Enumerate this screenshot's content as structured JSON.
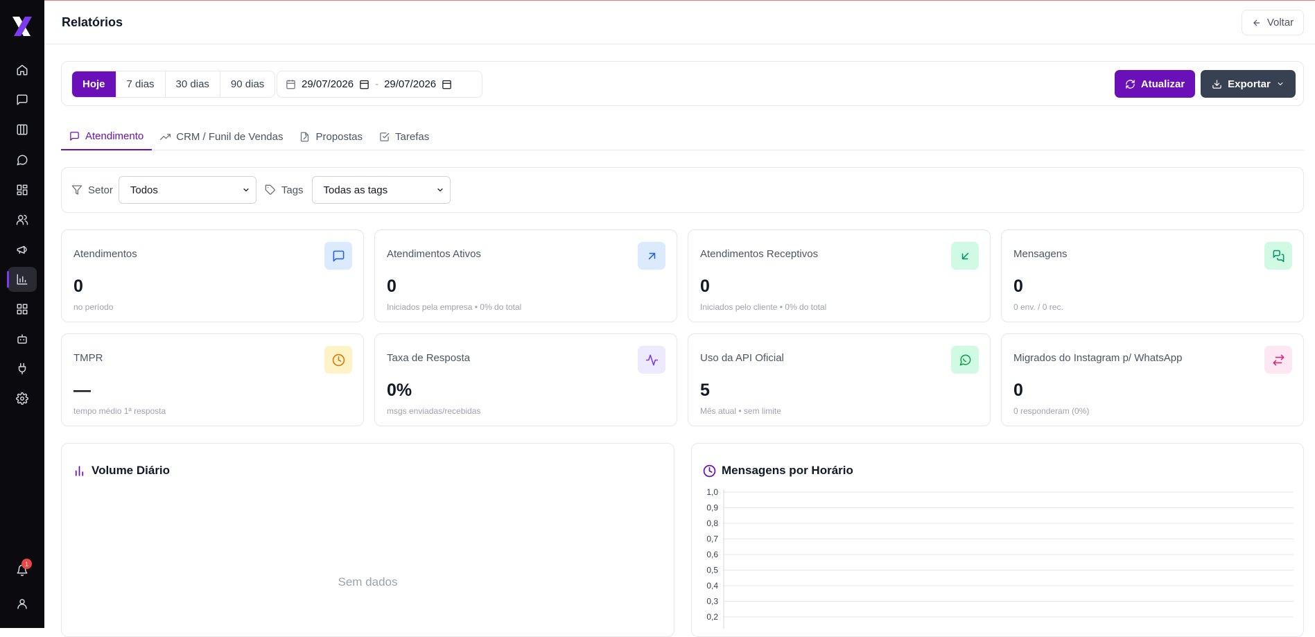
{
  "app": {
    "page_title": "Relatórios",
    "back_label": "Voltar",
    "notification_count": "1"
  },
  "sidebar": {
    "items": [
      "home-icon",
      "chat-icon",
      "kanban-icon",
      "message-circle-icon",
      "dashboard-icon",
      "users-icon",
      "megaphone-icon",
      "chart-icon",
      "apps-icon",
      "bot-icon",
      "plug-icon",
      "settings-icon"
    ]
  },
  "ranges": [
    {
      "label": "Hoje",
      "active": true
    },
    {
      "label": "7 dias"
    },
    {
      "label": "30 dias"
    },
    {
      "label": "90 dias"
    }
  ],
  "dates": {
    "start": "29/07/2026",
    "end": "29/07/2026",
    "separator": "-"
  },
  "actions": {
    "update": "Atualizar",
    "export": "Exportar"
  },
  "tabs": [
    {
      "label": "Atendimento",
      "active": true
    },
    {
      "label": "CRM / Funil de Vendas"
    },
    {
      "label": "Propostas"
    },
    {
      "label": "Tarefas"
    }
  ],
  "filters": {
    "sector_label": "Setor",
    "sector_value": "Todos",
    "tags_label": "Tags",
    "tags_value": "Todas as tags"
  },
  "cards": [
    {
      "title": "Atendimentos",
      "value": "0",
      "sub": "no período",
      "icon": "message-square-icon",
      "color": "#2563eb",
      "bg": "#dbeafe"
    },
    {
      "title": "Atendimentos Ativos",
      "value": "0",
      "sub": "Iniciados pela empresa • 0% do total",
      "icon": "arrow-up-right-icon",
      "color": "#2563eb",
      "bg": "#dbeafe"
    },
    {
      "title": "Atendimentos Receptivos",
      "value": "0",
      "sub": "Iniciados pelo cliente • 0% do total",
      "icon": "arrow-down-left-icon",
      "color": "#059669",
      "bg": "#d1fae5"
    },
    {
      "title": "Mensagens",
      "value": "0",
      "sub": "0 env. / 0 rec.",
      "icon": "messages-icon",
      "color": "#059669",
      "bg": "#d1fae5"
    },
    {
      "title": "TMPR",
      "value": "—",
      "sub": "tempo médio 1ª resposta",
      "icon": "clock-icon",
      "color": "#d97706",
      "bg": "#fef3c7"
    },
    {
      "title": "Taxa de Resposta",
      "value": "0%",
      "sub": "msgs enviadas/recebidas",
      "icon": "activity-icon",
      "color": "#7c3aed",
      "bg": "#ede9fe"
    },
    {
      "title": "Uso da API Oficial",
      "value": "5",
      "sub": "Mês atual • sem limite",
      "icon": "whatsapp-icon",
      "color": "#16a34a",
      "bg": "#d1fae5"
    },
    {
      "title": "Migrados do Instagram p/ WhatsApp",
      "value": "0",
      "sub": "0 responderam (0%)",
      "icon": "swap-icon",
      "color": "#db2777",
      "bg": "#fce7f3"
    }
  ],
  "panels": {
    "volume_title": "Volume Diário",
    "volume_empty": "Sem dados",
    "hourly_title": "Mensagens por Horário"
  },
  "chart_data": {
    "type": "line",
    "title": "Mensagens por Horário",
    "y_ticks": [
      "1,0",
      "0,9",
      "0,8",
      "0,7",
      "0,6",
      "0,5",
      "0,4",
      "0,3",
      "0,2"
    ],
    "ylim": [
      0,
      1
    ],
    "grid": true,
    "series": []
  }
}
